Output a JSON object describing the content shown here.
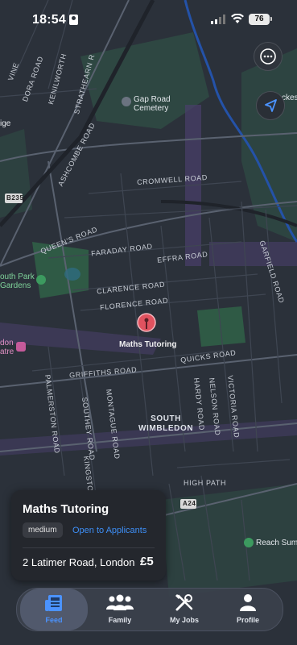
{
  "status_bar": {
    "time": "18:54",
    "battery": "76"
  },
  "map_labels": {
    "gap_road_cemetery": "Gap Road\nCemetery",
    "ashcombe_road": "ASHCOMBE ROAD",
    "cromwell_road": "CROMWELL ROAD",
    "queens_road": "QUEEN'S ROAD",
    "faraday_road": "FARADAY ROAD",
    "effra_road": "EFFRA ROAD",
    "garfield_road": "GARFIELD ROAD",
    "clarence_road": "CLARENCE ROAD",
    "florence_road": "FLORENCE ROAD",
    "quicks_road": "QUICKS ROAD",
    "griffiths_road": "GRIFFITHS ROAD",
    "palmerston_road": "PALMERSTON ROAD",
    "southey_road": "SOUTHEY ROAD",
    "montague_road": "MONTAGUE ROAD",
    "kingston_road": "KINGSTON ROAD",
    "hardy_road": "HARDY ROAD",
    "nelson_road": "NELSON ROAD",
    "victoria_road": "VICTORIA ROAD",
    "high_path": "HIGH PATH",
    "south_wimbledon": "SOUTH\nWIMBLEDON",
    "south_park_gardens": "outh Park\nGardens",
    "don_theatre": "don\natre",
    "ige": "ige",
    "reach_sum": "Reach Sum",
    "ckes": "ckes",
    "vine": "VINE",
    "dora_road": "DORA ROAD",
    "kenilworth": "KENILWORTH",
    "strathearn": "STRATHEARN R",
    "b235": "B235",
    "a24": "A24"
  },
  "pin": {
    "label": "Maths Tutoring",
    "color": "#e0525f"
  },
  "job_card": {
    "title": "Maths Tutoring",
    "difficulty": "medium",
    "status": "Open to Applicants",
    "address": "2 Latimer Road, London",
    "price": "£5"
  },
  "tabs": [
    {
      "id": "feed",
      "label": "Feed",
      "icon": "newspaper-icon",
      "active": true
    },
    {
      "id": "family",
      "label": "Family",
      "icon": "people-icon",
      "active": false
    },
    {
      "id": "jobs",
      "label": "My Jobs",
      "icon": "tools-icon",
      "active": false
    },
    {
      "id": "profile",
      "label": "Profile",
      "icon": "person-icon",
      "active": false
    }
  ],
  "colors": {
    "accent": "#3e8ff7",
    "map_bg": "#2b313a",
    "park": "#2f5a45",
    "water": "#2452a8",
    "purple_area": "#4a3f6b"
  }
}
